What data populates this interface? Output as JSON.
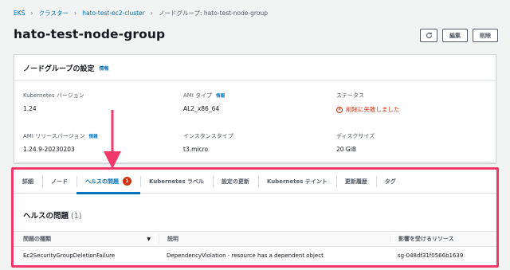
{
  "breadcrumb": {
    "items": [
      "EKS",
      "クラスター",
      "hato-test-ec2-cluster"
    ],
    "current": "ノードグループ: hato-test-node-group"
  },
  "header": {
    "title": "hato-test-node-group",
    "refresh_icon": "refresh-icon",
    "edit_label": "編集",
    "delete_label": "削除"
  },
  "config": {
    "title": "ノードグループの設定",
    "info_label": "情報",
    "fields": {
      "k8s_version": {
        "label": "Kubernetes バージョン",
        "value": "1.24"
      },
      "ami_type": {
        "label": "AMI タイプ",
        "info": "情報",
        "value": "AL2_x86_64"
      },
      "status": {
        "label": "ステータス",
        "value": "削除に失敗しました",
        "icon": "error-icon",
        "color": "#d13212"
      },
      "ami_release": {
        "label": "AMI リリースバージョン",
        "info": "情報",
        "value": "1.24.9-20230203"
      },
      "instance_type": {
        "label": "インスタンスタイプ",
        "value": "t3.micro"
      },
      "disk_size": {
        "label": "ディスクサイズ",
        "value": "20 GiB"
      }
    }
  },
  "tabs": [
    {
      "label": "詳細"
    },
    {
      "label": "ノード"
    },
    {
      "label": "ヘルスの問題",
      "badge": "1",
      "active": true
    },
    {
      "label": "Kubernetes ラベル"
    },
    {
      "label": "設定の更新"
    },
    {
      "label": "Kubernetes テイント"
    },
    {
      "label": "更新履歴"
    },
    {
      "label": "タグ"
    }
  ],
  "health_issues": {
    "title": "ヘルスの問題",
    "count": "(1)",
    "columns": [
      "問題の種類",
      "説明",
      "影響を受けるリソース"
    ],
    "rows": [
      [
        "Ec2SecurityGroupDeletionFailure",
        "DependencyViolation - resource has a dependent object",
        "sg-048df31f0566b1639"
      ]
    ]
  },
  "colors": {
    "accent": "#0073bb",
    "error": "#d13212",
    "annotation": "#f0386b"
  }
}
